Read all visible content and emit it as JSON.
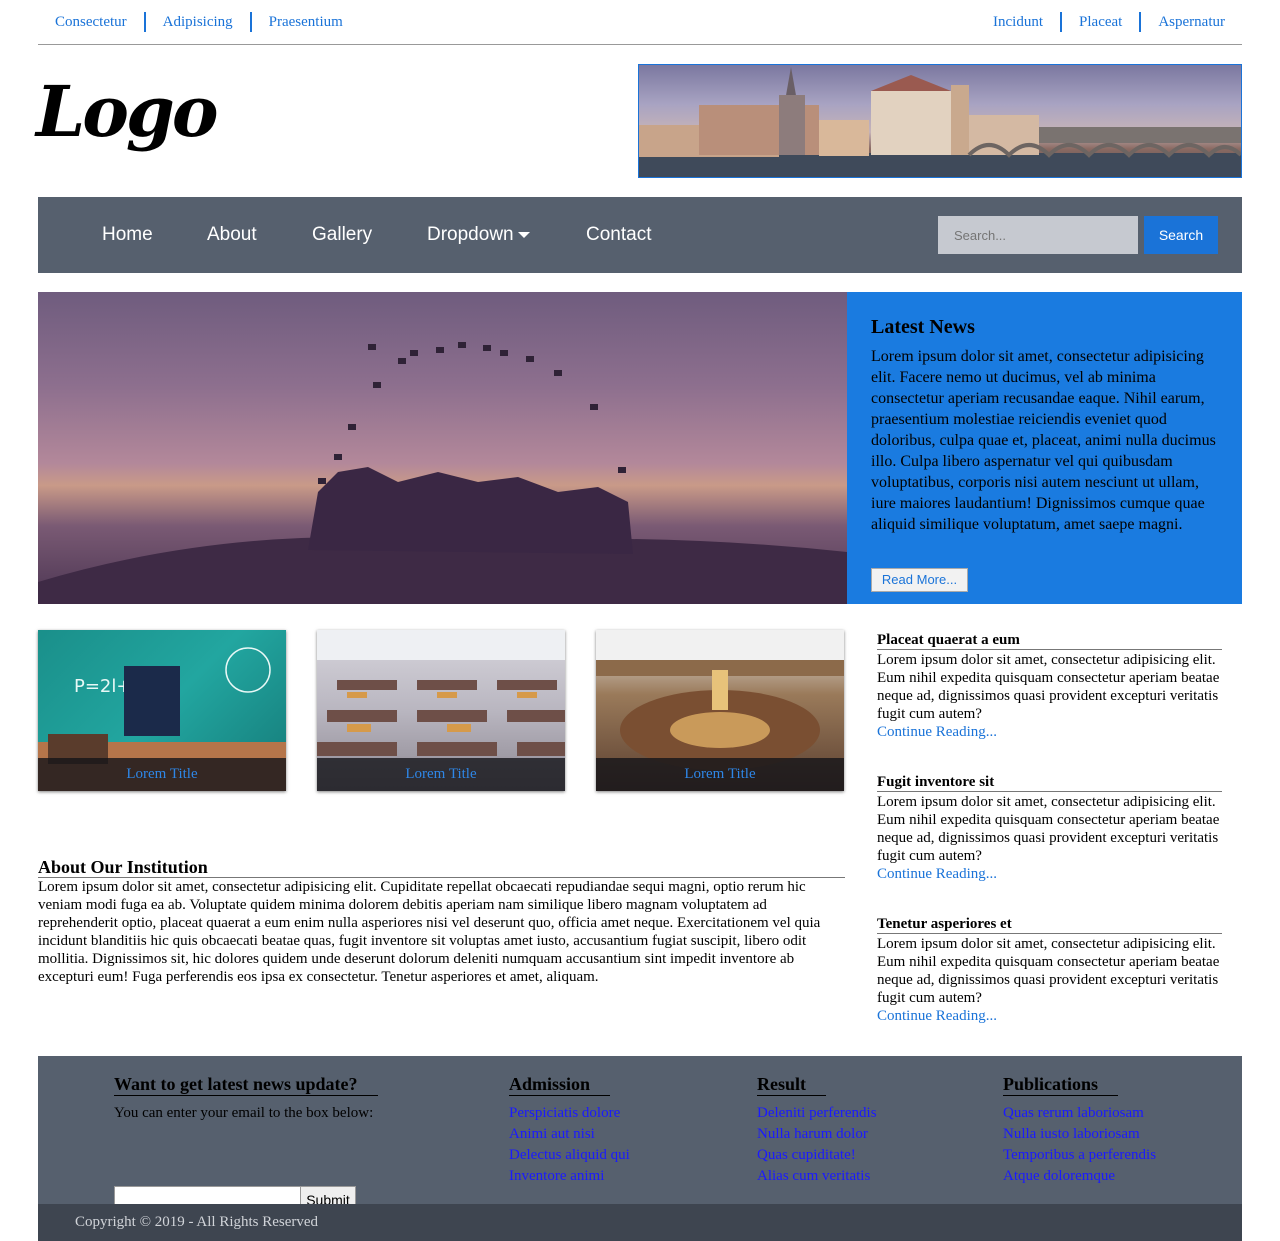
{
  "top_links": {
    "left": [
      "Consectetur",
      "Adipisicing",
      "Praesentium"
    ],
    "right": [
      "Incidunt",
      "Placeat",
      "Aspernatur"
    ]
  },
  "logo": "Logo",
  "nav": {
    "items": [
      "Home",
      "About",
      "Gallery",
      "Dropdown",
      "Contact"
    ],
    "search_placeholder": "Search...",
    "search_button": "Search"
  },
  "latest_news": {
    "title": "Latest News",
    "body": "Lorem ipsum dolor sit amet, consectetur adipisicing elit. Facere nemo ut ducimus, vel ab minima consectetur aperiam recusandae eaque. Nihil earum, praesentium molestiae reiciendis eveniet quod doloribus, culpa quae et, placeat, animi nulla ducimus illo. Culpa libero aspernatur vel qui quibusdam voluptatibus, corporis nisi autem nesciunt ut ullam, iure maiores laudantium! Dignissimos cumque quae aliquid similique voluptatum, amet saepe magni.",
    "button": "Read More..."
  },
  "cards": [
    {
      "caption": "Lorem Title"
    },
    {
      "caption": "Lorem Title"
    },
    {
      "caption": "Lorem Title"
    }
  ],
  "articles": [
    {
      "title": "Placeat quaerat a eum",
      "body": "Lorem ipsum dolor sit amet, consectetur adipisicing elit. Eum nihil expedita quisquam consectetur aperiam beatae neque ad, dignissimos quasi provident excepturi veritatis fugit cum autem?",
      "link": "Continue Reading..."
    },
    {
      "title": "Fugit inventore sit",
      "body": "Lorem ipsum dolor sit amet, consectetur adipisicing elit. Eum nihil expedita quisquam consectetur aperiam beatae neque ad, dignissimos quasi provident excepturi veritatis fugit cum autem?",
      "link": "Continue Reading..."
    },
    {
      "title": "Tenetur asperiores et",
      "body": "Lorem ipsum dolor sit amet, consectetur adipisicing elit. Eum nihil expedita quisquam consectetur aperiam beatae neque ad, dignissimos quasi provident excepturi veritatis fugit cum autem?",
      "link": "Continue Reading..."
    }
  ],
  "about": {
    "title": "About Our Institution",
    "body": "Lorem ipsum dolor sit amet, consectetur adipisicing elit. Cupiditate repellat obcaecati repudiandae sequi magni, optio rerum hic veniam modi fuga ea ab. Voluptate quidem minima dolorem debitis aperiam nam similique libero magnam voluptatem ad reprehenderit optio, placeat quaerat a eum enim nulla asperiores nisi vel deserunt quo, officia amet neque. Exercitationem vel quia incidunt blanditiis hic quis obcaecati beatae quas, fugit inventore sit voluptas amet iusto, accusantium fugiat suscipit, libero odit mollitia. Dignissimos sit, hic dolores quidem unde deserunt dolorum deleniti numquam accusantium sint impedit inventore ab excepturi eum! Fuga perferendis eos ipsa ex consectetur. Tenetur asperiores et amet, aliquam."
  },
  "footer": {
    "newsletter": {
      "title": "Want to get latest news update?",
      "desc": "You can enter your email to the box below:",
      "submit": "Submit"
    },
    "columns": [
      {
        "title": "Admission",
        "links": [
          "Perspiciatis dolore",
          "Animi aut nisi",
          "Delectus aliquid qui",
          "Inventore animi"
        ]
      },
      {
        "title": "Result",
        "links": [
          "Deleniti perferendis",
          "Nulla harum dolor",
          "Quas cupiditate!",
          "Alias cum veritatis"
        ]
      },
      {
        "title": "Publications",
        "links": [
          "Quas rerum laboriosam",
          "Nulla iusto laboriosam",
          "Temporibus a perferendis",
          "Atque doloremque"
        ]
      }
    ],
    "copyright": "Copyright © 2019 - All Rights Reserved"
  },
  "colors": {
    "accent": "#1a73d8",
    "navbar": "#56606e",
    "news_panel": "#1a7be0",
    "copyright_bar": "#3e4550"
  }
}
